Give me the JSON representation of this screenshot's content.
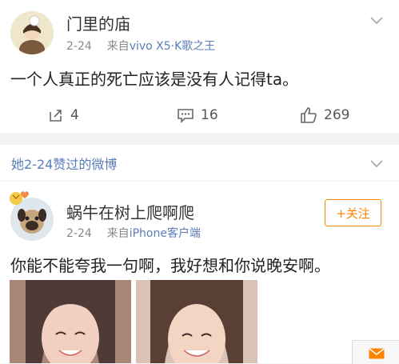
{
  "post1": {
    "username": "门里的庙",
    "date": "2-24",
    "source_prefix": "来自",
    "source": "vivo X5·K歌之王",
    "content": "一个人真正的死亡应该是没有人记得ta。",
    "repost_count": "4",
    "comment_count": "16",
    "like_count": "269"
  },
  "section": {
    "title": "她2-24赞过的微博"
  },
  "post2": {
    "username": "蜗牛在树上爬啊爬",
    "date": "2-24",
    "source_prefix": "来自",
    "source": "iPhone客户端",
    "follow_label": "+关注",
    "content": "你能不能夸我一句啊，我好想和你说晚安啊。"
  },
  "colors": {
    "link_blue": "#5b7eb8",
    "follow_orange": "#ff8200",
    "background": "#f2f2f2"
  },
  "icons": [
    "chevron-down-icon",
    "repost-icon",
    "comment-icon",
    "like-icon",
    "mail-icon",
    "heart-badge-icon"
  ]
}
